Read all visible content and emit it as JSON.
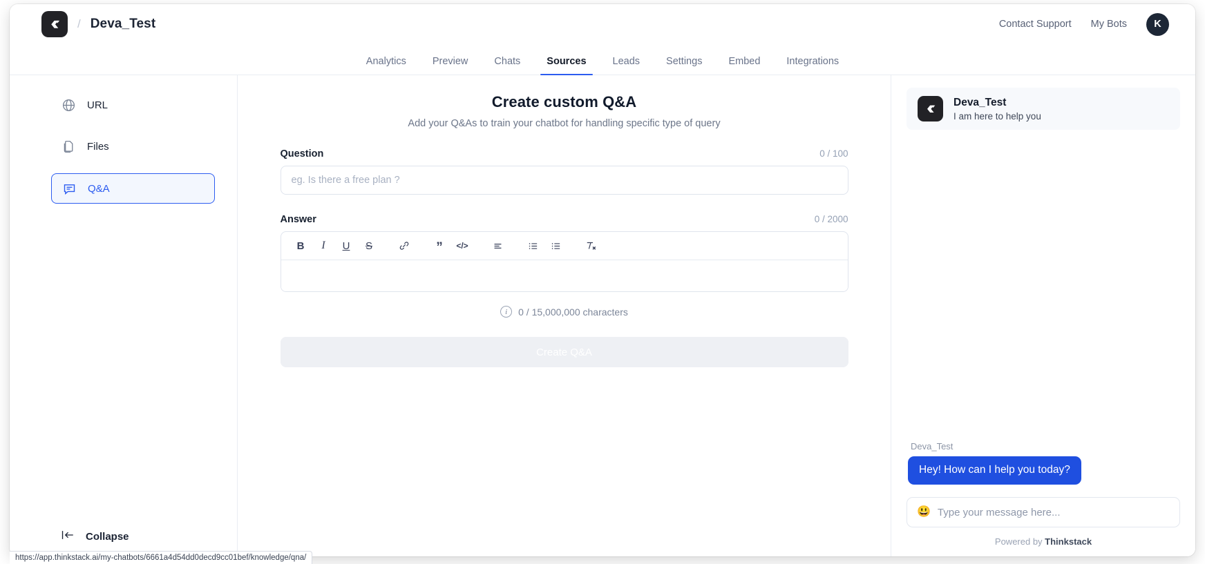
{
  "header": {
    "brand_name": "Deva_Test",
    "separator": "/",
    "logo_icon": "thinkstack-logo-icon",
    "contact_support": "Contact Support",
    "my_bots": "My Bots",
    "avatar_initial": "K"
  },
  "nav": {
    "tabs": [
      {
        "label": "Analytics",
        "active": false
      },
      {
        "label": "Preview",
        "active": false
      },
      {
        "label": "Chats",
        "active": false
      },
      {
        "label": "Sources",
        "active": true
      },
      {
        "label": "Leads",
        "active": false
      },
      {
        "label": "Settings",
        "active": false
      },
      {
        "label": "Embed",
        "active": false
      },
      {
        "label": "Integrations",
        "active": false
      }
    ],
    "active_accent": "#2c5cf0"
  },
  "sidebar": {
    "items": [
      {
        "label": "URL",
        "icon": "globe-icon",
        "selected": false
      },
      {
        "label": "Files",
        "icon": "files-icon",
        "selected": false
      },
      {
        "label": "Q&A",
        "icon": "chat-bubble-icon",
        "selected": true
      }
    ],
    "collapse_label": "Collapse",
    "collapse_icon": "collapse-left-arrow-icon"
  },
  "main": {
    "title": "Create custom Q&A",
    "subtitle": "Add your Q&As to train your chatbot for handling specific type of query",
    "question": {
      "label": "Question",
      "counter": "0 / 100",
      "placeholder": "eg. Is there a free plan ?",
      "value": ""
    },
    "answer": {
      "label": "Answer",
      "counter": "0 / 2000",
      "value": "",
      "toolbar": [
        {
          "name": "bold-icon",
          "glyph": "B"
        },
        {
          "name": "italic-icon",
          "glyph": "I"
        },
        {
          "name": "underline-icon",
          "glyph": "U"
        },
        {
          "name": "strikethrough-icon",
          "glyph": "S"
        },
        {
          "name": "link-icon",
          "glyph": "link"
        },
        {
          "name": "blockquote-icon",
          "glyph": "”"
        },
        {
          "name": "code-icon",
          "glyph": "</>"
        },
        {
          "name": "align-icon",
          "glyph": "align"
        },
        {
          "name": "ordered-list-icon",
          "glyph": "ol"
        },
        {
          "name": "bullet-list-icon",
          "glyph": "ul"
        },
        {
          "name": "clear-format-icon",
          "glyph": "Tx"
        }
      ]
    },
    "char_note": "0 / 15,000,000 characters",
    "char_note_icon": "info-icon",
    "submit_label": "Create Q&A",
    "submit_disabled": true
  },
  "chat_widget": {
    "header_name": "Deva_Test",
    "header_subtitle": "I am here to help you",
    "logo_icon": "thinkstack-logo-icon",
    "message_sender": "Deva_Test",
    "message_text": "Hey! How can I help you today?",
    "bubble_color": "#1f4fe0",
    "input_placeholder": "Type your message here...",
    "emoji_icon": "smiley-emoji-icon",
    "powered_prefix": "Powered by ",
    "powered_brand": "Thinkstack"
  },
  "status_bar": {
    "url": "https://app.thinkstack.ai/my-chatbots/6661a4d54dd0decd9cc01bef/knowledge/qna/"
  }
}
